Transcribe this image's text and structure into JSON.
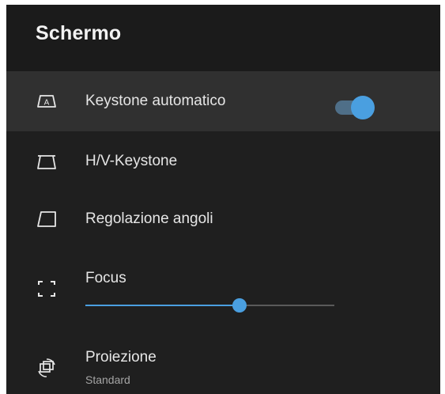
{
  "header": {
    "title": "Schermo"
  },
  "items": [
    {
      "id": "keystone-auto",
      "label": "Keystone automatico",
      "icon": "keystone-auto-icon",
      "toggle_on": true
    },
    {
      "id": "hv-keystone",
      "label": "H/V-Keystone",
      "icon": "hv-keystone-icon"
    },
    {
      "id": "corner-adjust",
      "label": "Regolazione angoli",
      "icon": "corner-adjust-icon"
    },
    {
      "id": "focus",
      "label": "Focus",
      "icon": "focus-icon",
      "slider_value": 0.62
    },
    {
      "id": "projection",
      "label": "Proiezione",
      "value": "Standard",
      "icon": "projection-icon"
    }
  ],
  "colors": {
    "accent": "#4a9fe0",
    "background": "#1f1f1f",
    "selected_row": "#303030"
  }
}
